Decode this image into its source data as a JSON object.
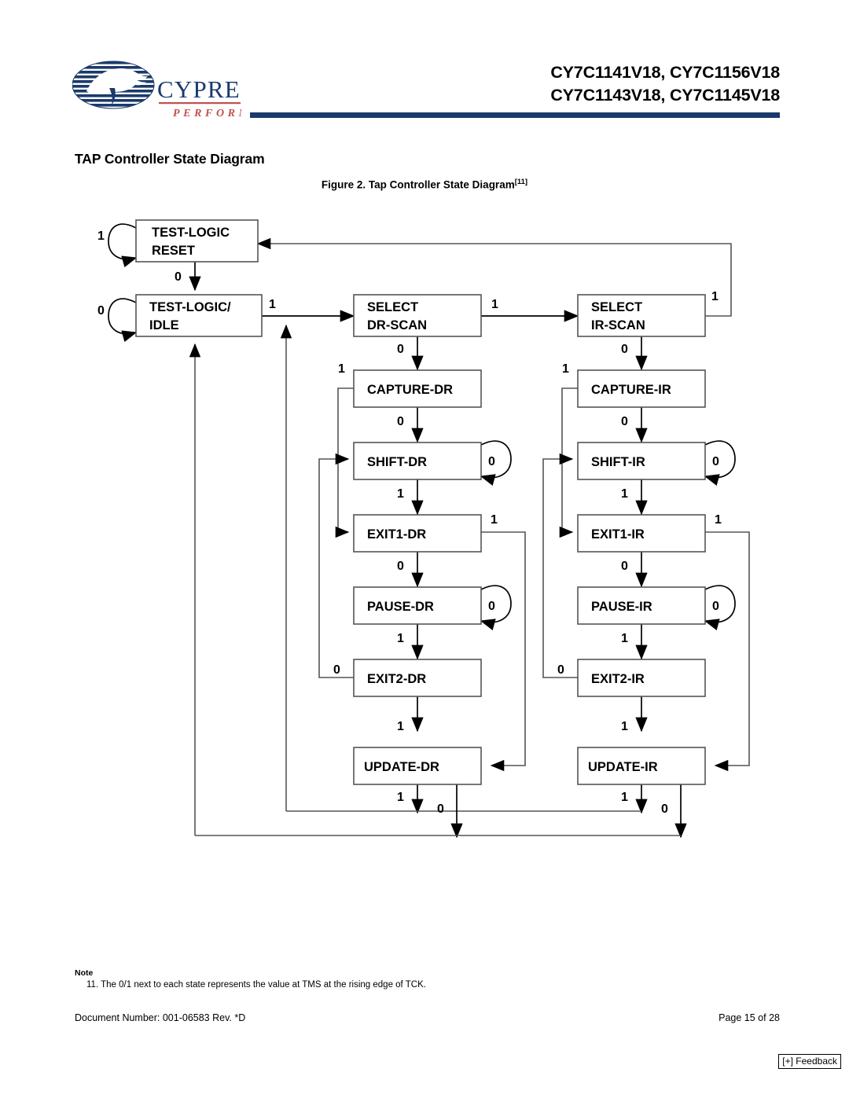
{
  "header": {
    "logo_name": "cypress-logo",
    "logo_wordmark": "CYPRESS",
    "logo_tagline": "PERFORM",
    "part_numbers_line1": "CY7C1141V18, CY7C1156V18",
    "part_numbers_line2": "CY7C1143V18, CY7C1145V18",
    "rule_color": "#1b3a6b"
  },
  "section_title": "TAP Controller State Diagram",
  "figure": {
    "caption_text": "Figure 2. Tap Controller State Diagram",
    "caption_ref": "[11]"
  },
  "diagram": {
    "states": {
      "test_logic_reset_l1": "TEST-LOGIC",
      "test_logic_reset_l2": "RESET",
      "test_logic_idle_l1": "TEST-LOGIC/",
      "test_logic_idle_l2": "IDLE",
      "select_dr_scan_l1": "SELECT",
      "select_dr_scan_l2": "DR-SCAN",
      "select_ir_scan_l1": "SELECT",
      "select_ir_scan_l2": "IR-SCAN",
      "capture_dr": "CAPTURE-DR",
      "capture_ir": "CAPTURE-IR",
      "shift_dr": "SHIFT-DR",
      "shift_ir": "SHIFT-IR",
      "exit1_dr": "EXIT1-DR",
      "exit1_ir": "EXIT1-IR",
      "pause_dr": "PAUSE-DR",
      "pause_ir": "PAUSE-IR",
      "exit2_dr": "EXIT2-DR",
      "exit2_ir": "EXIT2-IR",
      "update_dr": "UPDATE-DR",
      "update_ir": "UPDATE-IR"
    },
    "edge_labels": {
      "tlr_self": "1",
      "tlr_to_idle": "0",
      "idle_self": "0",
      "idle_to_seldr": "1",
      "seldr_to_selir": "1",
      "seldr_to_capdr": "0",
      "selir_to_tlr": "1",
      "selir_to_capir": "0",
      "capdr_exit1": "1",
      "capir_exit1": "1",
      "capdr_to_shiftdr": "0",
      "capir_to_shiftir": "0",
      "shiftdr_self": "0",
      "shiftir_self": "0",
      "shiftdr_to_exit1dr": "1",
      "shiftir_to_exit1ir": "1",
      "exit1dr_to_updatedr": "1",
      "exit1ir_to_updateir": "1",
      "exit1dr_to_pausedr": "0",
      "exit1ir_to_pauseir": "0",
      "pausedr_self": "0",
      "pauseir_self": "0",
      "pausedr_to_exit2dr": "1",
      "pauseir_to_exit2ir": "1",
      "exit2dr_to_shiftdr": "0",
      "exit2ir_to_shiftir": "0",
      "exit2dr_to_updatedr": "1",
      "exit2ir_to_updateir": "1",
      "updatedr_one": "1",
      "updatedr_zero": "0",
      "updateir_one": "1",
      "updateir_zero": "0"
    }
  },
  "note": {
    "heading": "Note",
    "text": "11. The 0/1 next to each state represents the value at TMS at the rising edge of TCK."
  },
  "footer": {
    "document": "Document Number: 001-06583  Rev. *D",
    "page": "Page 15 of 28",
    "feedback": "[+] Feedback"
  }
}
